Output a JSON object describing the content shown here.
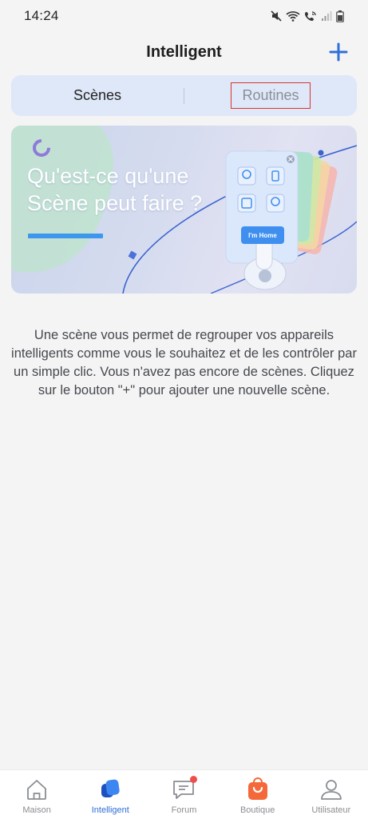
{
  "status_bar": {
    "time": "14:24",
    "icons": [
      "mute-icon",
      "wifi-icon",
      "wifi-call-icon",
      "signal-icon",
      "battery-icon"
    ]
  },
  "header": {
    "title": "Intelligent",
    "add_icon": "plus-icon"
  },
  "tabs": [
    {
      "label": "Scènes",
      "active": true
    },
    {
      "label": "Routines",
      "active": false
    }
  ],
  "banner": {
    "headline_line1": "Qu'est-ce qu'une",
    "headline_line2": "Scène peut faire ?",
    "button_label": "I'm Home"
  },
  "empty_state": {
    "message": "Une scène vous permet de regrouper vos appareils intelligents comme vous le souhaitez et de les contrôler par un simple clic. Vous n'avez pas encore de scènes. Cliquez sur le bouton \"+\" pour ajouter une nouvelle scène."
  },
  "bottom_nav": [
    {
      "label": "Maison",
      "icon": "home-icon",
      "active": false
    },
    {
      "label": "Intelligent",
      "icon": "smart-icon",
      "active": true
    },
    {
      "label": "Forum",
      "icon": "forum-icon",
      "active": false,
      "badge": true
    },
    {
      "label": "Boutique",
      "icon": "shop-bag-icon",
      "active": false
    },
    {
      "label": "Utilisateur",
      "icon": "user-icon",
      "active": false
    }
  ],
  "colors": {
    "accent": "#2f6fd6",
    "tab_bg": "#dfe8f8",
    "highlight_border": "#d9342b",
    "badge": "#f04d4d",
    "shop_orange": "#f4683a"
  }
}
